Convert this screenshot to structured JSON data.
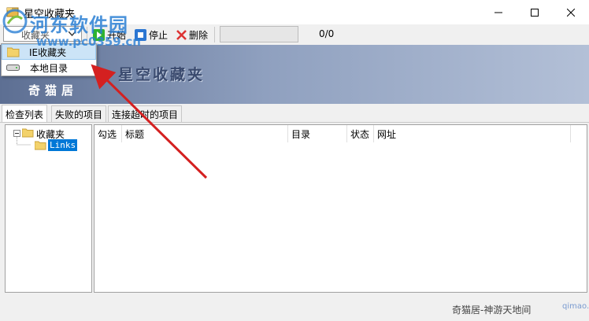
{
  "window": {
    "title": "星空收藏夹",
    "minimize_glyph": "—",
    "maximize_glyph": "☐",
    "close_glyph": "✕"
  },
  "toolbar": {
    "source_value": "收藏夹",
    "start_label": "开始",
    "stop_label": "停止",
    "delete_label": "删除",
    "progress_fraction": 0,
    "count_text": "0/0"
  },
  "dropdown": {
    "items": [
      {
        "label": "IE收藏夹",
        "icon": "folder-icon",
        "selected": true
      },
      {
        "label": "本地目录",
        "icon": "drive-icon",
        "selected": false
      }
    ]
  },
  "banner": {
    "title": "星空收藏夹",
    "logo": "奇猫居"
  },
  "tabs": [
    {
      "label": "检查列表",
      "active": true
    },
    {
      "label": "失败的项目",
      "active": false
    },
    {
      "label": "连接超时的项目",
      "active": false
    }
  ],
  "tree": {
    "root": {
      "label": "收藏夹",
      "expanded": true
    },
    "children": [
      {
        "label": "Links",
        "selected": true
      }
    ]
  },
  "list": {
    "columns": [
      "勾选",
      "标题",
      "目录",
      "状态",
      "网址"
    ]
  },
  "statusbar": {
    "text": "奇猫居-神游天地间",
    "watermark": "qimao.cn"
  },
  "watermark": {
    "text": "河东软件园",
    "url": "www.pc0359.cn"
  },
  "colors": {
    "accent_blue": "#2a7fd4",
    "arrow_red": "#d42020",
    "selection": "#0078d7",
    "start_green": "#2fb32f",
    "stop_blue": "#2b76d2",
    "delete_red": "#d33"
  }
}
